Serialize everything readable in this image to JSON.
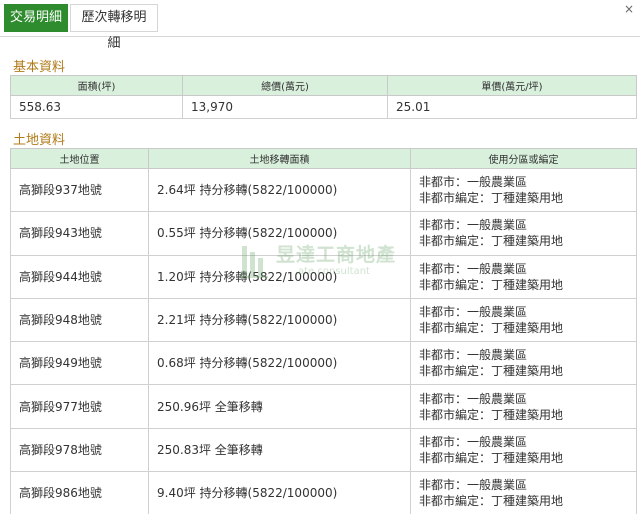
{
  "tabs": [
    {
      "label": "交易明細",
      "active": true
    },
    {
      "label": "歷次轉移明細",
      "active": false
    }
  ],
  "close_label": "×",
  "basic": {
    "title": "基本資料",
    "headers": [
      "面積(坪)",
      "總價(萬元)",
      "單價(萬元/坪)"
    ],
    "values": [
      "558.63",
      "13,970",
      "25.01"
    ]
  },
  "land": {
    "title": "土地資料",
    "headers": [
      "土地位置",
      "土地移轉面積",
      "使用分區或編定"
    ],
    "rows": [
      {
        "location": "高獅段937地號",
        "area": "2.64坪 持分移轉(5822/100000)",
        "zone1": "非都市：一般農業區",
        "zone2": "非都市編定：丁種建築用地"
      },
      {
        "location": "高獅段943地號",
        "area": "0.55坪 持分移轉(5822/100000)",
        "zone1": "非都市：一般農業區",
        "zone2": "非都市編定：丁種建築用地"
      },
      {
        "location": "高獅段944地號",
        "area": "1.20坪 持分移轉(5822/100000)",
        "zone1": "非都市：一般農業區",
        "zone2": "非都市編定：丁種建築用地"
      },
      {
        "location": "高獅段948地號",
        "area": "2.21坪 持分移轉(5822/100000)",
        "zone1": "非都市：一般農業區",
        "zone2": "非都市編定：丁種建築用地"
      },
      {
        "location": "高獅段949地號",
        "area": "0.68坪 持分移轉(5822/100000)",
        "zone1": "非都市：一般農業區",
        "zone2": "非都市編定：丁種建築用地"
      },
      {
        "location": "高獅段977地號",
        "area": "250.96坪 全筆移轉",
        "zone1": "非都市：一般農業區",
        "zone2": "非都市編定：丁種建築用地"
      },
      {
        "location": "高獅段978地號",
        "area": "250.83坪 全筆移轉",
        "zone1": "非都市：一般農業區",
        "zone2": "非都市編定：丁種建築用地"
      },
      {
        "location": "高獅段986地號",
        "area": "9.40坪 持分移轉(5822/100000)",
        "zone1": "非都市：一般農業區",
        "zone2": "非都市編定：丁種建築用地"
      }
    ]
  },
  "watermark": {
    "text": "昱達工商地產",
    "sub": "ate consultant"
  },
  "colors": {
    "accent": "#2e8b2e",
    "header_bg": "#d9f0dc",
    "section_title": "#b07a1a"
  }
}
